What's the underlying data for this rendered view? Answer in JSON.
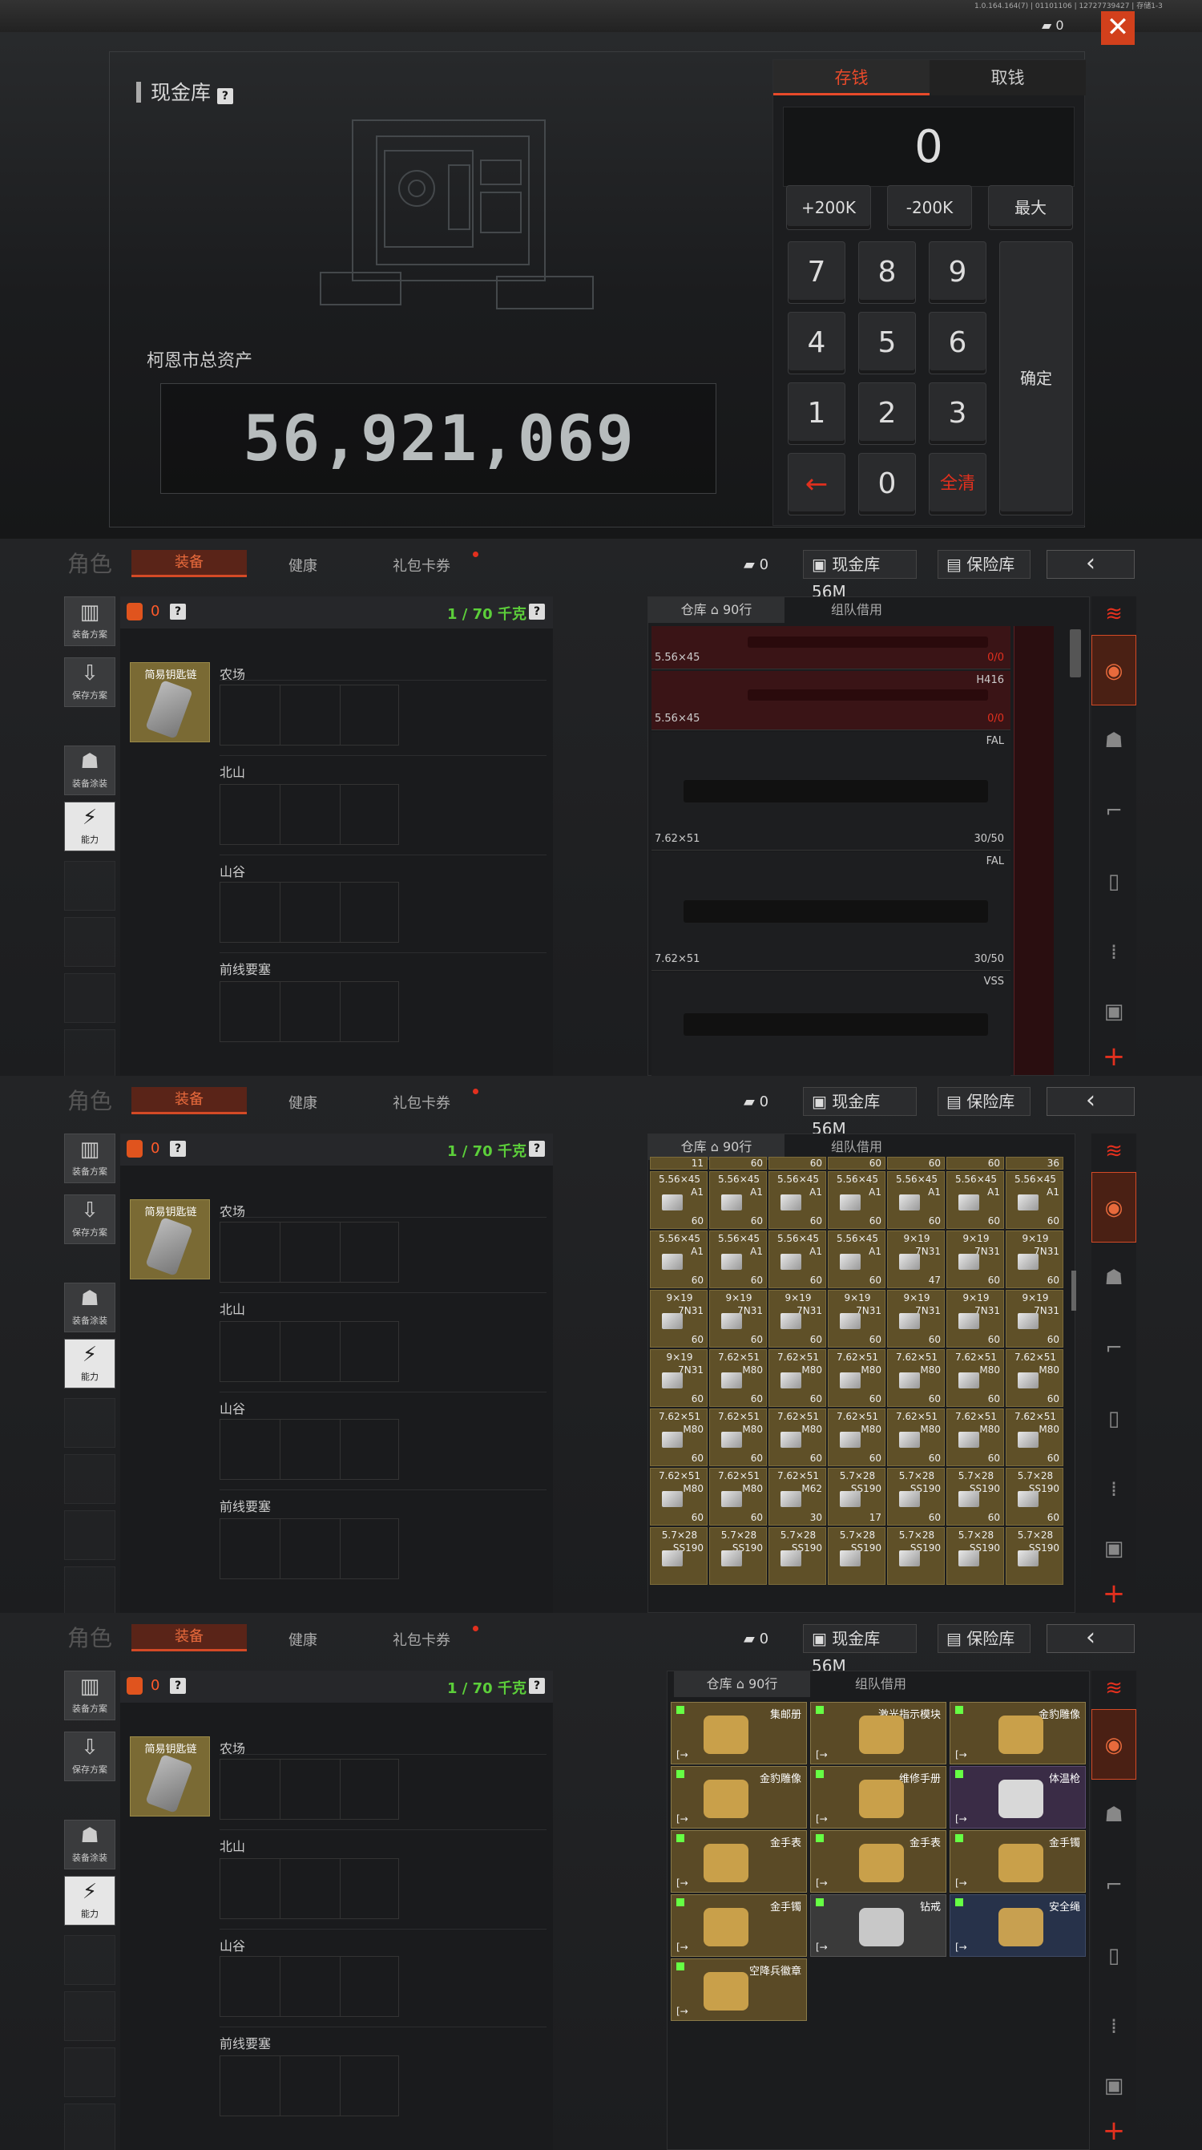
{
  "vault": {
    "title": "现金库",
    "help": "?",
    "total_label": "柯恩市总资产",
    "total_value": "56,921,069",
    "tab_deposit": "存钱",
    "tab_withdraw": "取钱",
    "display": "0",
    "plus": "+200K",
    "minus": "-200K",
    "max": "最大",
    "confirm": "确定",
    "clear": "全清",
    "backspace": "←",
    "digits": [
      "7",
      "8",
      "9",
      "4",
      "5",
      "6",
      "1",
      "2",
      "3",
      "0"
    ],
    "cash": "0",
    "close": "✕",
    "version": "1.0.164.164(7) | 01101106 | 12727739427 | 存储1-3"
  },
  "topbar": {
    "role": "角色",
    "tab_equip": "装备",
    "tab_health": "健康",
    "tab_gift": "礼包卡券",
    "cash": "0",
    "vault_btn": "现金库 56M",
    "safe_btn": "保险库",
    "back": "‹"
  },
  "left": {
    "b1": "装备方案",
    "b2": "保存方案",
    "b3": "装备涂装",
    "b4": "能力"
  },
  "mid": {
    "bag_count": "0",
    "help": "?",
    "weight": "1 / 70 千克",
    "key_label": "简易钥匙链",
    "maps": [
      "农场",
      "北山",
      "山谷",
      "前线要塞"
    ]
  },
  "storage": {
    "tab_wh": "仓库 ⌂ 90行",
    "tab_team": "组队借用"
  },
  "guns": [
    {
      "name": "",
      "cal": "5.56×45",
      "cnt": "0/0"
    },
    {
      "name": "H416",
      "cal": "5.56×45",
      "cnt": "0/0"
    },
    {
      "name": "FAL",
      "cal": "7.62×51",
      "cnt": "30/50"
    },
    {
      "name": "FAL",
      "cal": "7.62×51",
      "cnt": "30/50"
    },
    {
      "name": "VSS",
      "cal": "",
      "cnt": ""
    }
  ],
  "ammo_rows": [
    [
      {
        "c": "",
        "t": "",
        "n": "11"
      },
      {
        "c": "",
        "t": "",
        "n": "60"
      },
      {
        "c": "",
        "t": "",
        "n": "60"
      },
      {
        "c": "",
        "t": "",
        "n": "60"
      },
      {
        "c": "",
        "t": "",
        "n": "60"
      },
      {
        "c": "",
        "t": "",
        "n": "60"
      },
      {
        "c": "",
        "t": "",
        "n": "36"
      }
    ],
    [
      {
        "c": "5.56×45",
        "t": "A1",
        "n": "60"
      },
      {
        "c": "5.56×45",
        "t": "A1",
        "n": "60"
      },
      {
        "c": "5.56×45",
        "t": "A1",
        "n": "60"
      },
      {
        "c": "5.56×45",
        "t": "A1",
        "n": "60"
      },
      {
        "c": "5.56×45",
        "t": "A1",
        "n": "60"
      },
      {
        "c": "5.56×45",
        "t": "A1",
        "n": "60"
      },
      {
        "c": "5.56×45",
        "t": "A1",
        "n": "60"
      }
    ],
    [
      {
        "c": "5.56×45",
        "t": "A1",
        "n": "60"
      },
      {
        "c": "5.56×45",
        "t": "A1",
        "n": "60"
      },
      {
        "c": "5.56×45",
        "t": "A1",
        "n": "60"
      },
      {
        "c": "5.56×45",
        "t": "A1",
        "n": "60"
      },
      {
        "c": "9×19",
        "t": "7N31",
        "n": "47"
      },
      {
        "c": "9×19",
        "t": "7N31",
        "n": "60"
      },
      {
        "c": "9×19",
        "t": "7N31",
        "n": "60"
      }
    ],
    [
      {
        "c": "9×19",
        "t": "7N31",
        "n": "60"
      },
      {
        "c": "9×19",
        "t": "7N31",
        "n": "60"
      },
      {
        "c": "9×19",
        "t": "7N31",
        "n": "60"
      },
      {
        "c": "9×19",
        "t": "7N31",
        "n": "60"
      },
      {
        "c": "9×19",
        "t": "7N31",
        "n": "60"
      },
      {
        "c": "9×19",
        "t": "7N31",
        "n": "60"
      },
      {
        "c": "9×19",
        "t": "7N31",
        "n": "60"
      }
    ],
    [
      {
        "c": "9×19",
        "t": "7N31",
        "n": "60"
      },
      {
        "c": "7.62×51",
        "t": "M80",
        "n": "60"
      },
      {
        "c": "7.62×51",
        "t": "M80",
        "n": "60"
      },
      {
        "c": "7.62×51",
        "t": "M80",
        "n": "60"
      },
      {
        "c": "7.62×51",
        "t": "M80",
        "n": "60"
      },
      {
        "c": "7.62×51",
        "t": "M80",
        "n": "60"
      },
      {
        "c": "7.62×51",
        "t": "M80",
        "n": "60"
      }
    ],
    [
      {
        "c": "7.62×51",
        "t": "M80",
        "n": "60"
      },
      {
        "c": "7.62×51",
        "t": "M80",
        "n": "60"
      },
      {
        "c": "7.62×51",
        "t": "M80",
        "n": "60"
      },
      {
        "c": "7.62×51",
        "t": "M80",
        "n": "60"
      },
      {
        "c": "7.62×51",
        "t": "M80",
        "n": "60"
      },
      {
        "c": "7.62×51",
        "t": "M80",
        "n": "60"
      },
      {
        "c": "7.62×51",
        "t": "M80",
        "n": "60"
      }
    ],
    [
      {
        "c": "7.62×51",
        "t": "M80",
        "n": "60"
      },
      {
        "c": "7.62×51",
        "t": "M80",
        "n": "60"
      },
      {
        "c": "7.62×51",
        "t": "M62",
        "n": "30"
      },
      {
        "c": "5.7×28",
        "t": "SS190",
        "n": "17"
      },
      {
        "c": "5.7×28",
        "t": "SS190",
        "n": "60"
      },
      {
        "c": "5.7×28",
        "t": "SS190",
        "n": "60"
      },
      {
        "c": "5.7×28",
        "t": "SS190",
        "n": "60"
      }
    ],
    [
      {
        "c": "5.7×28",
        "t": "SS190",
        "n": ""
      },
      {
        "c": "5.7×28",
        "t": "SS190",
        "n": ""
      },
      {
        "c": "5.7×28",
        "t": "SS190",
        "n": ""
      },
      {
        "c": "5.7×28",
        "t": "SS190",
        "n": ""
      },
      {
        "c": "5.7×28",
        "t": "SS190",
        "n": ""
      },
      {
        "c": "5.7×28",
        "t": "SS190",
        "n": ""
      },
      {
        "c": "5.7×28",
        "t": "SS190",
        "n": ""
      }
    ]
  ],
  "items": [
    {
      "name": "集邮册",
      "color": "gold"
    },
    {
      "name": "激光指示模块",
      "color": "gold"
    },
    {
      "name": "金豹雕像",
      "color": "gold"
    },
    {
      "name": "金豹雕像",
      "color": "gold"
    },
    {
      "name": "维修手册",
      "color": "gold"
    },
    {
      "name": "体温枪",
      "color": "purple"
    },
    {
      "name": "金手表",
      "color": "gold"
    },
    {
      "name": "金手表",
      "color": "gold"
    },
    {
      "name": "金手镯",
      "color": "gold"
    },
    {
      "name": "金手镯",
      "color": "gold"
    },
    {
      "name": "钻戒",
      "color": "gray"
    },
    {
      "name": "安全绳",
      "color": "blue"
    },
    {
      "name": "空降兵徽章",
      "color": "gold"
    }
  ],
  "colors": {
    "accent": "#e84a2a",
    "weight_green": "#5ccf3a",
    "gold_item": "#5a4a26"
  }
}
